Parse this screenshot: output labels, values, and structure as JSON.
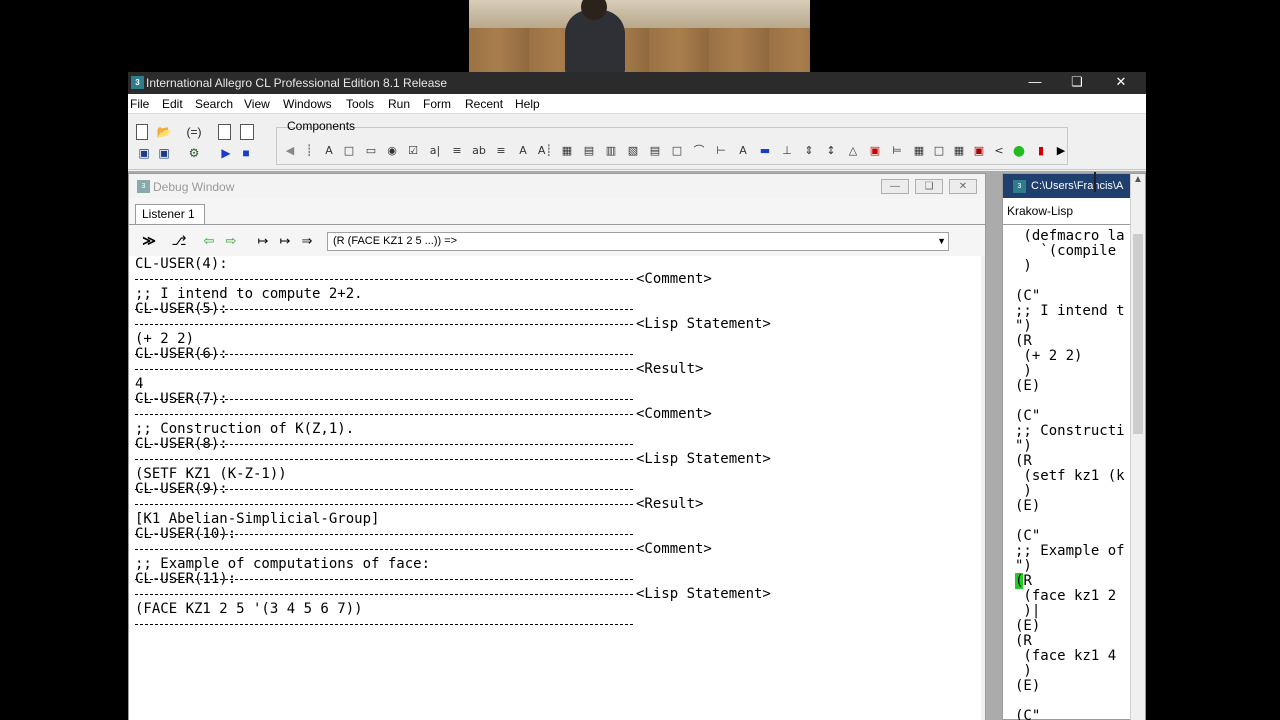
{
  "window": {
    "title": "International Allegro CL Professional Edition 8.1 Release",
    "icon_text": "3"
  },
  "menu": [
    "File",
    "Edit",
    "Search",
    "View",
    "Windows",
    "Tools",
    "Run",
    "Form",
    "Recent",
    "Help"
  ],
  "toolbar": {
    "components_label": "Components"
  },
  "debug_window": {
    "title": "Debug Window",
    "tab": "Listener 1",
    "command_box": "(R (FACE KZ1 2 5 ...))    =>"
  },
  "listener": {
    "lines": [
      {
        "text": "CL-USER(4):",
        "type": "prompt"
      },
      {
        "text": "<Comment>",
        "type": "tag"
      },
      {
        "text": ";; I intend to compute 2+2.",
        "type": "code"
      },
      {
        "text": "CL-USER(5):",
        "type": "prompt"
      },
      {
        "text": "<Lisp Statement>",
        "type": "tag"
      },
      {
        "text": "(+ 2 2)",
        "type": "code"
      },
      {
        "text": "CL-USER(6):",
        "type": "prompt"
      },
      {
        "text": "<Result>",
        "type": "tag"
      },
      {
        "text": "4",
        "type": "code"
      },
      {
        "text": "CL-USER(7):",
        "type": "prompt"
      },
      {
        "text": "<Comment>",
        "type": "tag"
      },
      {
        "text": ";; Construction of K(Z,1).",
        "type": "code"
      },
      {
        "text": "CL-USER(8):",
        "type": "prompt"
      },
      {
        "text": "<Lisp Statement>",
        "type": "tag"
      },
      {
        "text": "(SETF KZ1 (K-Z-1))",
        "type": "code"
      },
      {
        "text": "CL-USER(9):",
        "type": "prompt"
      },
      {
        "text": "<Result>",
        "type": "tag"
      },
      {
        "text": "[K1 Abelian-Simplicial-Group]",
        "type": "code"
      },
      {
        "text": "CL-USER(10):",
        "type": "prompt"
      },
      {
        "text": "<Comment>",
        "type": "tag"
      },
      {
        "text": ";; Example of computations of face:",
        "type": "code"
      },
      {
        "text": "CL-USER(11):",
        "type": "prompt"
      },
      {
        "text": "<Lisp Statement>",
        "type": "tag"
      },
      {
        "text": "(FACE KZ1 2 5 '(3 4 5 6 7))",
        "type": "code"
      }
    ]
  },
  "editor": {
    "title": "C:\\Users\\Francis\\A",
    "tab": "Krakow-Lisp",
    "lines": [
      " (defmacro la",
      "   `(compile ",
      " )",
      "",
      "(C\"",
      ";; I intend t",
      "\")",
      "(R",
      " (+ 2 2)",
      " )",
      "(E)",
      "",
      "(C\"",
      ";; Constructi",
      "\")",
      "(R",
      " (setf kz1 (k",
      " )",
      "(E)",
      "",
      "(C\"",
      ";; Example of",
      "\")",
      "(R",
      " (face kz1 2 ",
      " )|",
      "(E)",
      "(R",
      " (face kz1 4 ",
      " )",
      "(E)",
      "",
      "(C\""
    ]
  }
}
